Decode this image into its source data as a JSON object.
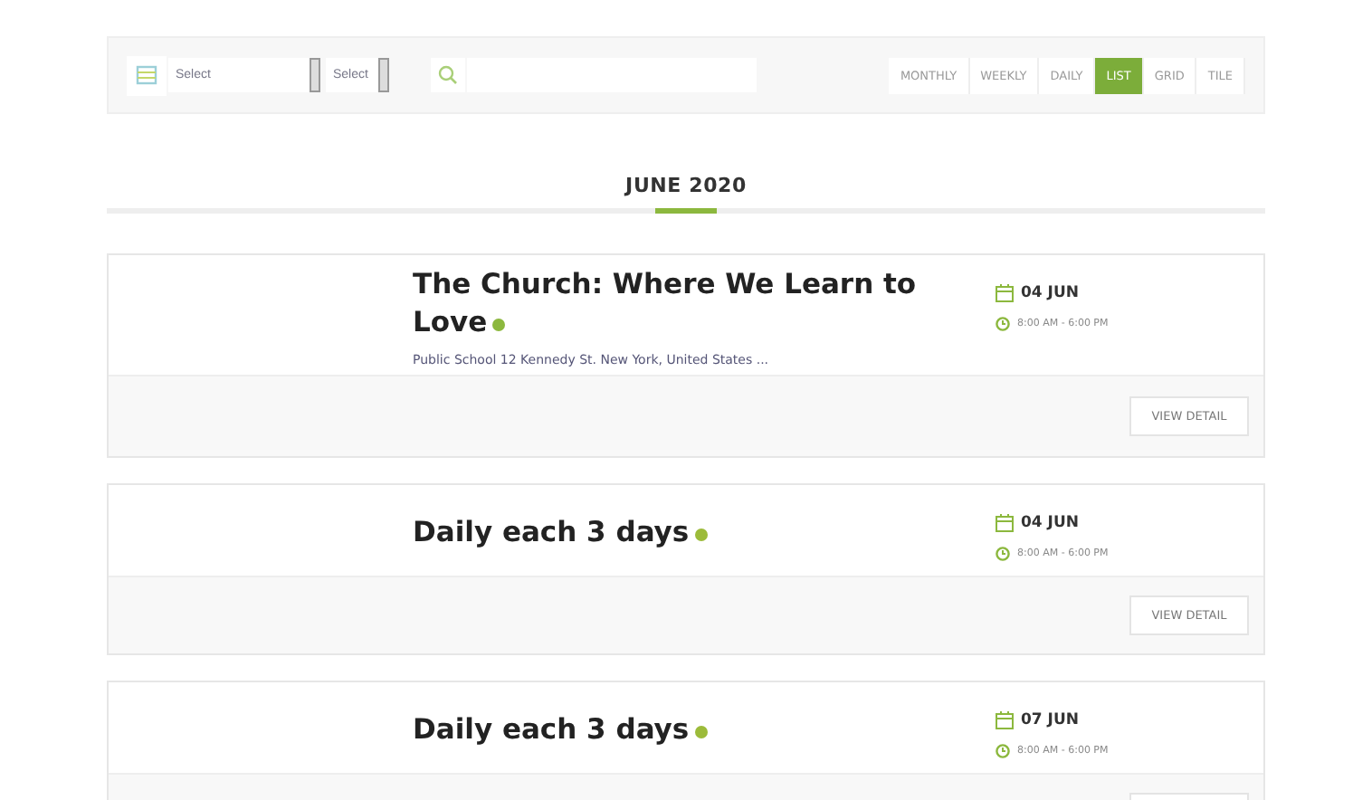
{
  "filters": {
    "date_select": "Select",
    "second_select": "Select"
  },
  "views": [
    {
      "label": "MONTHLY",
      "selected": false
    },
    {
      "label": "WEEKLY",
      "selected": false
    },
    {
      "label": "DAILY",
      "selected": false
    },
    {
      "label": "LIST",
      "selected": true
    },
    {
      "label": "GRID",
      "selected": false
    },
    {
      "label": "TILE",
      "selected": false
    }
  ],
  "month": "JUNE 2020",
  "events": [
    {
      "title": "The Church: Where We Learn to Love",
      "color": "#8cb83e",
      "location": "Public School 12 Kennedy St. New York, United States ...",
      "date": "04 JUN",
      "time": "8:00 AM - 6:00 PM",
      "button": "VIEW DETAIL"
    },
    {
      "title": "Daily each 3 days",
      "color": "#9cbb3a",
      "date": "04 JUN",
      "time": "8:00 AM - 6:00 PM",
      "button": "VIEW DETAIL"
    },
    {
      "title": "Daily each 3 days",
      "color": "#9cbb3a",
      "date": "07 JUN",
      "time": "8:00 AM - 6:00 PM"
    }
  ]
}
